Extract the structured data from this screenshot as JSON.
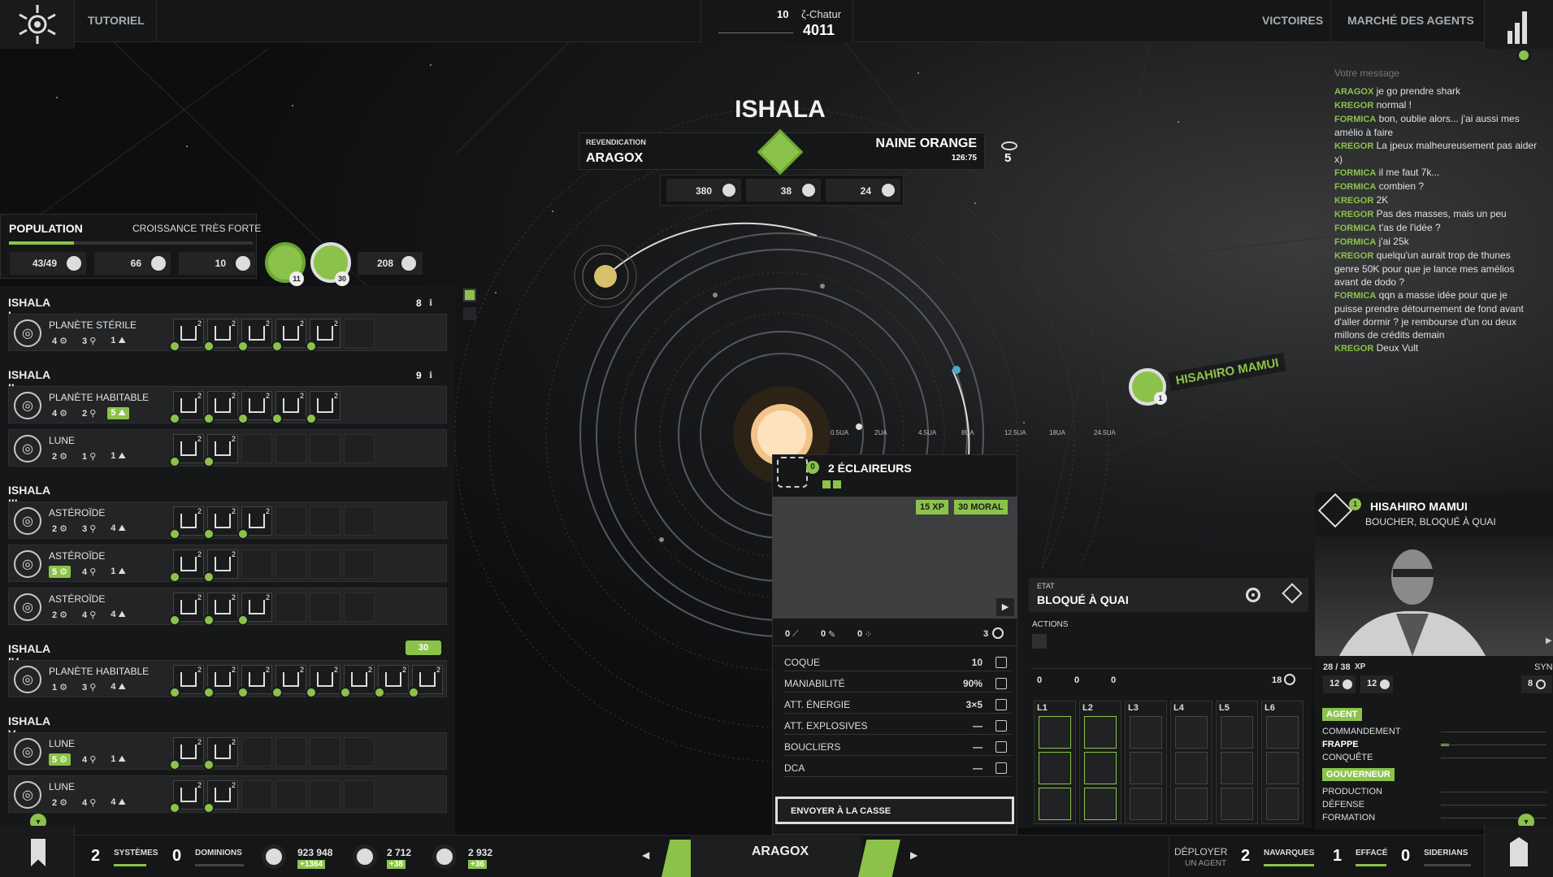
{
  "top": {
    "tutorial": "TUTORIEL",
    "victories": "VICTOIRES",
    "agent_market": "MARCHÉ DES AGENTS",
    "currency_small": "10",
    "currency_name": "ζ-Chatur",
    "currency_value": "4011"
  },
  "system": {
    "name": "ISHALA",
    "claim_label": "REVENDICATION",
    "claim_owner": "ARAGOX",
    "star_type": "NAINE ORANGE",
    "star_coords": "126:75",
    "visibility": "5",
    "res1": "380",
    "res2": "38",
    "res3": "24",
    "distances": [
      "0.5UA",
      "2UA",
      "4.5UA",
      "8UA",
      "12.5UA",
      "18UA",
      "24.5UA"
    ]
  },
  "population": {
    "title": "POPULATION",
    "growth": "CROISSANCE TRÈS FORTE",
    "pop": "43/49",
    "housing": "66",
    "v3": "10",
    "badge1": "11",
    "badge2": "30",
    "v4": "208"
  },
  "planets": [
    {
      "section": "ISHALA I",
      "count": "8",
      "bodies": [
        {
          "name": "PLANÈTE STÉRILE",
          "a": "4",
          "b": "3",
          "c": "1"
        }
      ]
    },
    {
      "section": "ISHALA II",
      "count": "9",
      "bodies": [
        {
          "name": "PLANÈTE HABITABLE",
          "a": "4",
          "b": "2",
          "c": "5"
        },
        {
          "name": "LUNE",
          "a": "2",
          "b": "1",
          "c": "1"
        }
      ]
    },
    {
      "section": "ISHALA III",
      "count": "",
      "bodies": [
        {
          "name": "ASTÉROÏDE",
          "a": "2",
          "b": "3",
          "c": "4"
        },
        {
          "name": "ASTÉROÏDE",
          "a": "5",
          "b": "4",
          "c": "1"
        },
        {
          "name": "ASTÉROÏDE",
          "a": "2",
          "b": "4",
          "c": "4"
        }
      ]
    },
    {
      "section": "ISHALA IV",
      "count": "30",
      "bodies": [
        {
          "name": "PLANÈTE HABITABLE",
          "a": "1",
          "b": "3",
          "c": "4"
        }
      ]
    },
    {
      "section": "ISHALA V",
      "count": "",
      "bodies": [
        {
          "name": "LUNE",
          "a": "5",
          "b": "4",
          "c": "1"
        },
        {
          "name": "LUNE",
          "a": "2",
          "b": "4",
          "c": "4"
        }
      ]
    }
  ],
  "chat": {
    "placeholder": "Votre message",
    "messages": [
      {
        "who": "ARAGOX",
        "text": " je go prendre shark"
      },
      {
        "who": "KREGOR",
        "text": " normal !"
      },
      {
        "who": "FORMICA",
        "text": " bon, oublie alors... j'ai aussi mes amélio à faire"
      },
      {
        "who": "KREGOR",
        "text": " La jpeux malheureusement pas aider x)"
      },
      {
        "who": "FORMICA",
        "text": " il me faut 7k..."
      },
      {
        "who": "FORMICA",
        "text": " combien ?"
      },
      {
        "who": "KREGOR",
        "text": " 2K"
      },
      {
        "who": "KREGOR",
        "text": " Pas des masses, mais un peu"
      },
      {
        "who": "FORMICA",
        "text": " t'as de l'idée ?"
      },
      {
        "who": "FORMICA",
        "text": " j'ai 25k"
      },
      {
        "who": "KREGOR",
        "text": " quelqu'un aurait trop de thunes genre 50K pour que je lance mes amélios avant de dodo ?"
      },
      {
        "who": "FORMICA",
        "text": " qqn a masse idée pour que je puisse prendre détournement de fond avant d'aller dormir ? je rembourse d'un ou deux millons de crédits demain"
      },
      {
        "who": "KREGOR",
        "text": " Deux Vult"
      }
    ]
  },
  "fleet_marker": {
    "name": "HISAHIRO MAMUI",
    "badge": "1"
  },
  "ship": {
    "count": "0",
    "title": "2 ÉCLAIREURS",
    "xp": "15 XP",
    "moral": "30 MORAL",
    "w1": "0",
    "w2": "0",
    "w3": "0",
    "shield": "3",
    "stats": [
      {
        "label": "COQUE",
        "value": "10"
      },
      {
        "label": "MANIABILITÉ",
        "value": "90%"
      },
      {
        "label": "ATT. ÉNERGIE",
        "value": "3×5"
      },
      {
        "label": "ATT. EXPLOSIVES",
        "value": "—"
      },
      {
        "label": "BOUCLIERS",
        "value": "—"
      },
      {
        "label": "DCA",
        "value": "—"
      }
    ],
    "scrap_button": "ENVOYER À LA CASSE"
  },
  "state": {
    "label": "ETAT",
    "value": "BLOQUÉ À QUAI",
    "actions": "ACTIONS",
    "w1": "0",
    "w2": "0",
    "w3": "0",
    "cap": "18",
    "levels": [
      "L1",
      "L2",
      "L3",
      "L4",
      "L5",
      "L6"
    ]
  },
  "agent": {
    "name": "HISAHIRO MAMUI",
    "subtitle": "BOUCHER, BLOQUÉ À QUAI",
    "level": "1",
    "xp": "28 / 38",
    "xp_unit": "XP",
    "s1": "12",
    "s2": "12",
    "syn": "SYN",
    "s3": "8",
    "cat1": "AGENT",
    "skills1": [
      "COMMANDEMENT",
      "FRAPPE",
      "CONQUÊTE"
    ],
    "cat2": "GOUVERNEUR",
    "skills2": [
      "PRODUCTION",
      "DÉFENSE",
      "FORMATION"
    ]
  },
  "bottom": {
    "systems_n": "2",
    "systems": "SYSTÈMES",
    "dominions_n": "0",
    "dominions": "DOMINIONS",
    "credits": "923 948",
    "credits_inc": "+1364",
    "tech": "2 712",
    "tech_inc": "+38",
    "ideo": "2 932",
    "ideo_inc": "+36",
    "player": "ARAGOX",
    "deploy1": "DÉPLOYER",
    "deploy2": "UN AGENT",
    "nav_n": "2",
    "nav": "NAVARQUES",
    "eff_n": "1",
    "eff": "EFFACÉ",
    "sid_n": "0",
    "sid": "SIDERIANS"
  }
}
